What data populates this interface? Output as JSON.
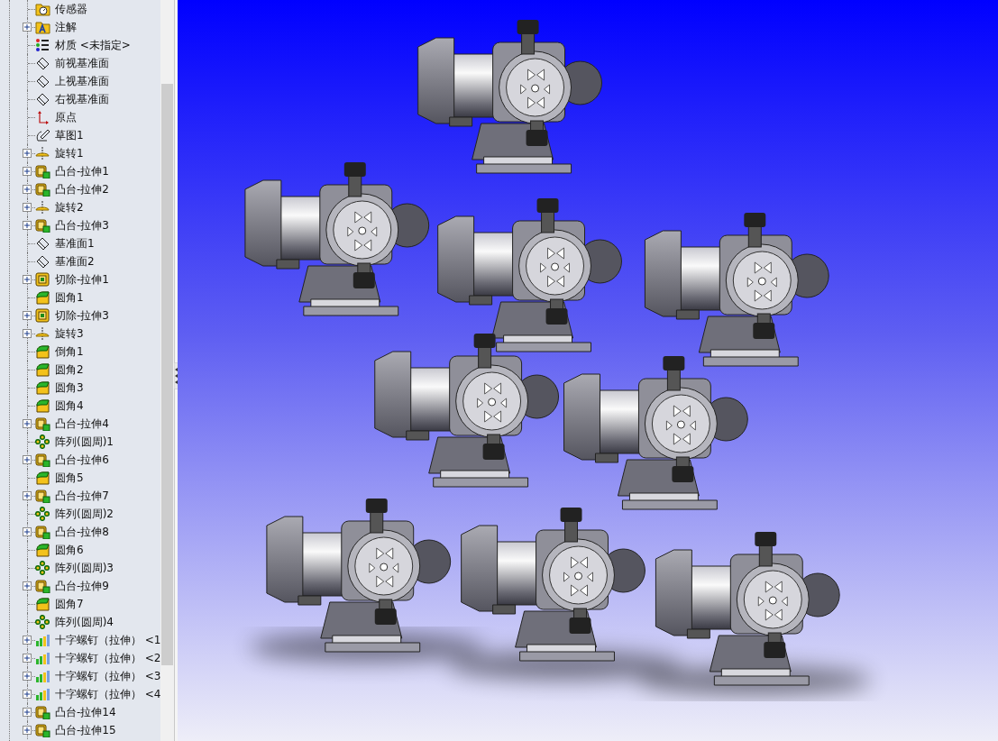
{
  "feature_tree": {
    "items": [
      {
        "label": "传感器",
        "kind": "sensor-folder",
        "expander": false
      },
      {
        "label": "注解",
        "kind": "annotation-folder",
        "expander": true
      },
      {
        "label": "材质 <未指定>",
        "kind": "material",
        "expander": false
      },
      {
        "label": "前视基准面",
        "kind": "plane",
        "expander": false
      },
      {
        "label": "上视基准面",
        "kind": "plane",
        "expander": false
      },
      {
        "label": "右视基准面",
        "kind": "plane",
        "expander": false
      },
      {
        "label": "原点",
        "kind": "origin",
        "expander": false
      },
      {
        "label": "草图1",
        "kind": "sketch",
        "expander": false
      },
      {
        "label": "旋转1",
        "kind": "revolve",
        "expander": true
      },
      {
        "label": "凸台-拉伸1",
        "kind": "boss",
        "expander": true
      },
      {
        "label": "凸台-拉伸2",
        "kind": "boss",
        "expander": true
      },
      {
        "label": "旋转2",
        "kind": "revolve",
        "expander": true
      },
      {
        "label": "凸台-拉伸3",
        "kind": "boss",
        "expander": true
      },
      {
        "label": "基准面1",
        "kind": "plane",
        "expander": false
      },
      {
        "label": "基准面2",
        "kind": "plane",
        "expander": false
      },
      {
        "label": "切除-拉伸1",
        "kind": "cut",
        "expander": true
      },
      {
        "label": "圆角1",
        "kind": "fillet",
        "expander": false
      },
      {
        "label": "切除-拉伸3",
        "kind": "cut",
        "expander": true
      },
      {
        "label": "旋转3",
        "kind": "revolve",
        "expander": true
      },
      {
        "label": "倒角1",
        "kind": "fillet",
        "expander": false
      },
      {
        "label": "圆角2",
        "kind": "fillet",
        "expander": false
      },
      {
        "label": "圆角3",
        "kind": "fillet",
        "expander": false
      },
      {
        "label": "圆角4",
        "kind": "fillet",
        "expander": false
      },
      {
        "label": "凸台-拉伸4",
        "kind": "boss",
        "expander": true
      },
      {
        "label": "阵列(圆周)1",
        "kind": "pattern",
        "expander": false
      },
      {
        "label": "凸台-拉伸6",
        "kind": "boss",
        "expander": true
      },
      {
        "label": "圆角5",
        "kind": "fillet",
        "expander": false
      },
      {
        "label": "凸台-拉伸7",
        "kind": "boss",
        "expander": true
      },
      {
        "label": "阵列(圆周)2",
        "kind": "pattern",
        "expander": false
      },
      {
        "label": "凸台-拉伸8",
        "kind": "boss",
        "expander": true
      },
      {
        "label": "圆角6",
        "kind": "fillet",
        "expander": false
      },
      {
        "label": "阵列(圆周)3",
        "kind": "pattern",
        "expander": false
      },
      {
        "label": "凸台-拉伸9",
        "kind": "boss",
        "expander": true
      },
      {
        "label": "圆角7",
        "kind": "fillet",
        "expander": false
      },
      {
        "label": "阵列(圆周)4",
        "kind": "pattern",
        "expander": false
      },
      {
        "label": "十字螺钉（拉伸） <1",
        "kind": "part",
        "expander": true
      },
      {
        "label": "十字螺钉（拉伸） <2",
        "kind": "part",
        "expander": true
      },
      {
        "label": "十字螺钉（拉伸） <3",
        "kind": "part",
        "expander": true
      },
      {
        "label": "十字螺钉（拉伸） <4",
        "kind": "part",
        "expander": true
      },
      {
        "label": "凸台-拉伸14",
        "kind": "boss",
        "expander": true
      },
      {
        "label": "凸台-拉伸15",
        "kind": "boss",
        "expander": true
      }
    ]
  },
  "viewport": {
    "models": [
      {
        "kind": "pump"
      },
      {
        "kind": "pump"
      },
      {
        "kind": "pump"
      },
      {
        "kind": "pump"
      },
      {
        "kind": "pump"
      },
      {
        "kind": "pump"
      },
      {
        "kind": "pump"
      },
      {
        "kind": "pump"
      },
      {
        "kind": "pump"
      }
    ]
  }
}
